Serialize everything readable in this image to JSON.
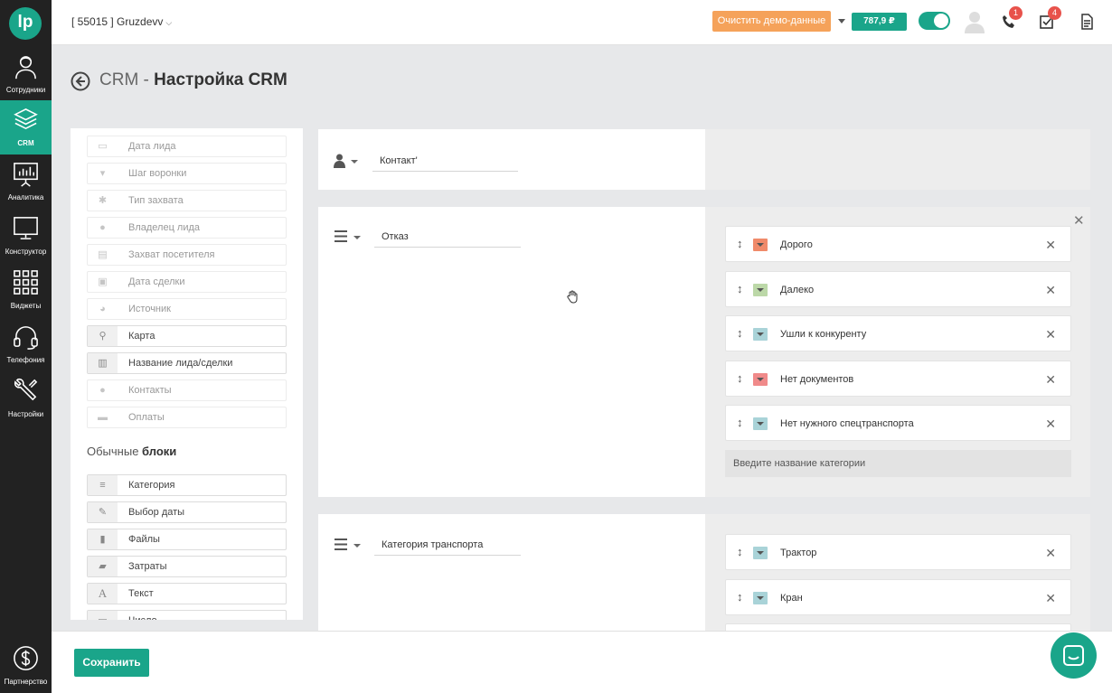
{
  "nav": {
    "logo": "lp",
    "items": [
      {
        "label": "Сотрудники",
        "icon": "user-icon",
        "active": false
      },
      {
        "label": "CRM",
        "icon": "layers-icon",
        "active": true
      },
      {
        "label": "Аналитика",
        "icon": "presentation-chart-icon",
        "active": false
      },
      {
        "label": "Конструктор",
        "icon": "monitor-icon",
        "active": false
      },
      {
        "label": "Виджеты",
        "icon": "grid-icon",
        "active": false
      },
      {
        "label": "Телефония",
        "icon": "headset-icon",
        "active": false
      },
      {
        "label": "Настройки",
        "icon": "wrench-icon",
        "active": false
      }
    ],
    "partner": {
      "label": "Партнерство",
      "icon": "dollar-icon"
    }
  },
  "header": {
    "account": "[ 55015 ] Gruzdevv",
    "demo_button": "Очистить демо-данные",
    "balance": "787,9 ₽",
    "phone_badge": "1",
    "tasks_badge": "4"
  },
  "page": {
    "title_prefix": "CRM - ",
    "title_main": "Настройка CRM"
  },
  "fields_panel": {
    "system_items": [
      {
        "label": "Дата лида",
        "icon": "calendar-icon",
        "enabled": false
      },
      {
        "label": "Шаг воронки",
        "icon": "funnel-icon",
        "enabled": false
      },
      {
        "label": "Тип захвата",
        "icon": "asterisk-icon",
        "enabled": false
      },
      {
        "label": "Владелец лида",
        "icon": "user-small-icon",
        "enabled": false
      },
      {
        "label": "Захват посетителя",
        "icon": "id-card-icon",
        "enabled": false
      },
      {
        "label": "Дата сделки",
        "icon": "money-icon",
        "enabled": false
      },
      {
        "label": "Источник",
        "icon": "pie-icon",
        "enabled": false
      },
      {
        "label": "Карта",
        "icon": "map-pin-icon",
        "enabled": true
      },
      {
        "label": "Название лида/сделки",
        "icon": "document-icon",
        "enabled": true
      },
      {
        "label": "Контакты",
        "icon": "user-small-icon",
        "enabled": false
      },
      {
        "label": "Оплаты",
        "icon": "credit-card-icon",
        "enabled": false
      }
    ],
    "section_title_light": "Обычные ",
    "section_title_bold": "блоки",
    "regular_items": [
      {
        "label": "Категория",
        "icon": "list-icon"
      },
      {
        "label": "Выбор даты",
        "icon": "pencil-icon"
      },
      {
        "label": "Файлы",
        "icon": "file-icon"
      },
      {
        "label": "Затраты",
        "icon": "briefcase-icon"
      },
      {
        "label": "Текст",
        "icon": "text-a-icon"
      },
      {
        "label": "Число",
        "icon": "number-icon"
      }
    ]
  },
  "blocks": {
    "contact": {
      "name": "Контакт'"
    },
    "refusal": {
      "name": "Отказ",
      "options": [
        {
          "label": "Дорого",
          "color": "#f08a6a"
        },
        {
          "label": "Далеко",
          "color": "#bcd8a8"
        },
        {
          "label": "Ушли к конкуренту",
          "color": "#a9d3d8"
        },
        {
          "label": "Нет документов",
          "color": "#f08a8a"
        },
        {
          "label": "Нет нужного спецтранспорта",
          "color": "#a9d3d8"
        }
      ],
      "new_category_placeholder": "Введите название категории"
    },
    "transport": {
      "name": "Категория транспорта",
      "options": [
        {
          "label": "Трактор",
          "color": "#a9d3d8"
        },
        {
          "label": "Кран",
          "color": "#a9d3d8"
        }
      ]
    }
  },
  "footer": {
    "save_label": "Сохранить"
  }
}
